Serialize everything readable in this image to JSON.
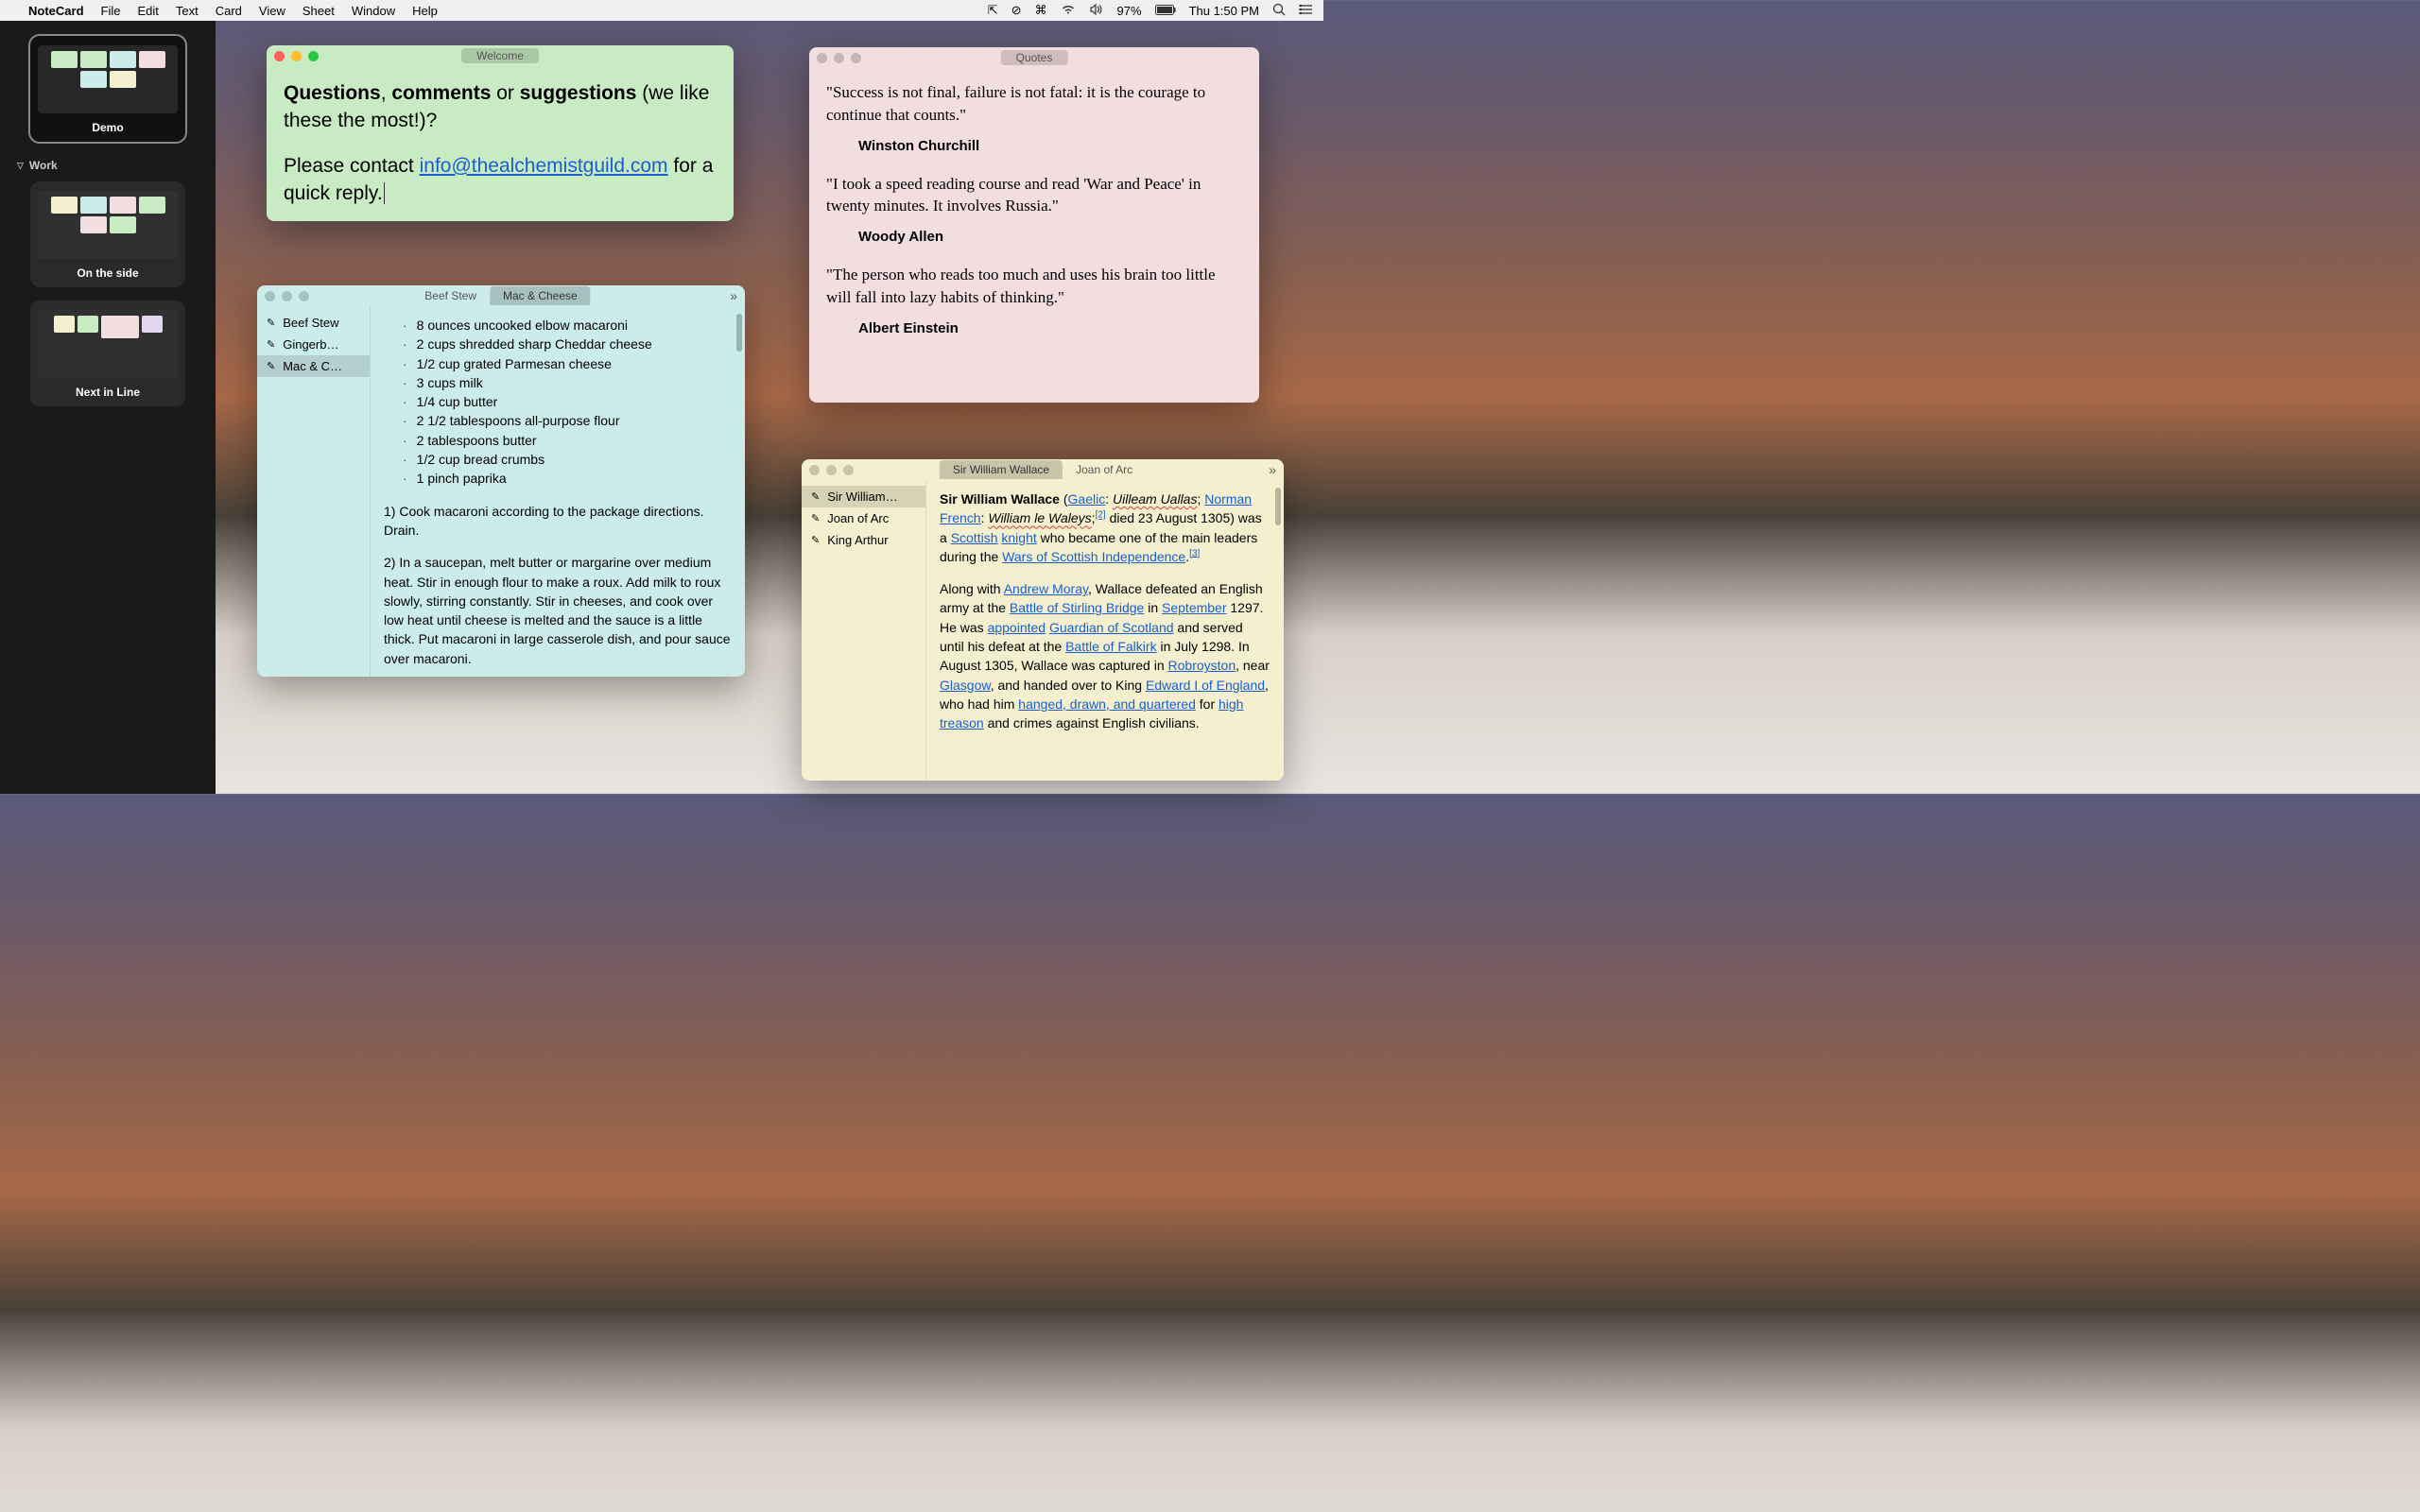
{
  "menubar": {
    "app": "NoteCard",
    "items": [
      "File",
      "Edit",
      "Text",
      "Card",
      "View",
      "Sheet",
      "Window",
      "Help"
    ],
    "battery_pct": "97%",
    "clock": "Thu 1:50 PM"
  },
  "sidebar": {
    "thumbs_top": [
      {
        "label": "Demo",
        "selected": true
      }
    ],
    "group": "Work",
    "thumbs_work": [
      {
        "label": "On the side",
        "selected": false
      },
      {
        "label": "Next in Line",
        "selected": false
      }
    ]
  },
  "welcome": {
    "title": "Welcome",
    "body_strong1": "Questions",
    "body_sep1": ", ",
    "body_strong2": "comments",
    "body_sep2": " or ",
    "body_strong3": "suggestions",
    "body_rest": " (we like these the most!)?",
    "body_line2a": "Please contact ",
    "email": "info@thealchemistguild.com",
    "body_line2b": " for a quick reply."
  },
  "recipes": {
    "tabs": [
      "Beef Stew",
      "Mac & Cheese"
    ],
    "active_tab": 1,
    "sidebar_items": [
      "Beef Stew",
      "Gingerb…",
      "Mac & C…"
    ],
    "selected_item": 2,
    "ingredients": [
      "8 ounces uncooked elbow macaroni",
      "2 cups shredded sharp Cheddar cheese",
      "1/2 cup grated Parmesan cheese",
      "3 cups milk",
      "1/4 cup butter",
      "2 1/2 tablespoons all-purpose flour",
      "2 tablespoons butter",
      "1/2 cup bread crumbs",
      "1 pinch paprika"
    ],
    "step1": "1) Cook macaroni according to the package directions. Drain.",
    "step2": "2) In a saucepan, melt butter or margarine over medium heat. Stir in enough flour to make a roux. Add milk to roux slowly, stirring constantly. Stir in cheeses, and cook over low heat until cheese is melted and the sauce is a little thick. Put macaroni in large casserole dish, and pour sauce over macaroni."
  },
  "quotes": {
    "title": "Quotes",
    "q1": "\"Success is not final, failure is not fatal: it is the courage to continue that counts.\"",
    "a1": "Winston Churchill",
    "q2": "\"I took a speed reading course and read 'War and Peace' in twenty minutes. It involves Russia.\"",
    "a2": "Woody Allen",
    "q3": "\"The person who reads too much and uses his brain too little will fall into lazy habits of thinking.\"",
    "a3": "Albert Einstein"
  },
  "history": {
    "tabs": [
      "Sir William Wallace",
      "Joan of Arc"
    ],
    "active_tab": 0,
    "sidebar_items": [
      "Sir William…",
      "Joan of Arc",
      "King Arthur"
    ],
    "selected_item": 0,
    "title_bold": "Sir William Wallace",
    "para1_a": " (",
    "link_gaelic": "Gaelic",
    "para1_b": ": ",
    "ital1": "Uilleam Uallas",
    "para1_c": "; ",
    "link_norman": "Norman French",
    "para1_d": ": ",
    "ital2": "William le Waleys",
    "para1_e": ";",
    "sup2": "[2]",
    "para1_f": " died 23 August 1305) was a ",
    "link_scottish": "Scottish",
    "sp": " ",
    "link_knight": "knight",
    "para1_g": " who became one of the main leaders during the ",
    "link_wars": "Wars of Scottish Independence",
    "para1_h": ".",
    "sup3": "[3]",
    "para2_a": "Along with ",
    "link_moray": "Andrew Moray",
    "para2_b": ", Wallace defeated an English army at the ",
    "link_stirling": "Battle of Stirling Bridge",
    "para2_c": " in ",
    "link_september": "September",
    "para2_d": " 1297. He was ",
    "link_appointed": "appointed",
    "link_guardian": "Guardian of Scotland",
    "para2_e": " and served until his defeat at the ",
    "link_falkirk": "Battle of Falkirk",
    "para2_f": " in July 1298. In August 1305, Wallace was captured in ",
    "link_robroyston": "Robroyston",
    "para2_g": ", near ",
    "link_glasgow": "Glasgow",
    "para2_h": ", and handed over to King ",
    "link_edward": "Edward I of England",
    "para2_i": ", who had him ",
    "link_hanged": "hanged, drawn, and quartered",
    "para2_j": " for ",
    "link_treason": "high treason",
    "para2_k": " and crimes against English civilians."
  }
}
